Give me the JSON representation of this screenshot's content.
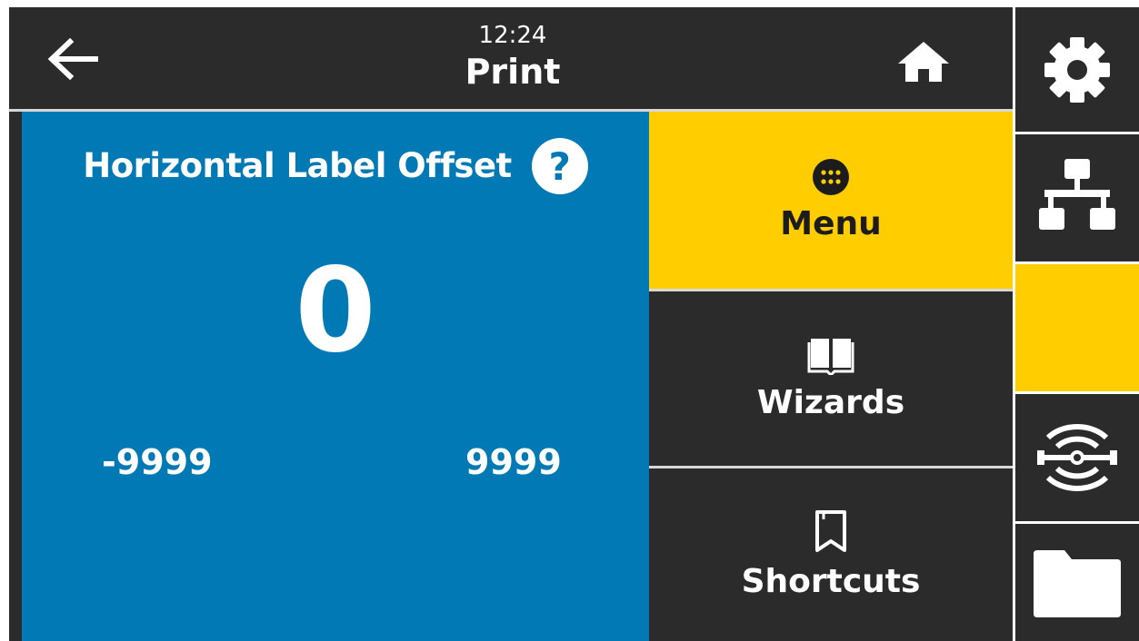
{
  "header": {
    "time": "12:24",
    "title": "Print"
  },
  "setting": {
    "title": "Horizontal Label Offset",
    "help_symbol": "?",
    "value": "0",
    "min": "-9999",
    "max": "9999"
  },
  "menu": {
    "items": [
      {
        "label": "Menu",
        "icon": "menu-dots-icon",
        "active": true
      },
      {
        "label": "Wizards",
        "icon": "book-icon",
        "active": false
      },
      {
        "label": "Shortcuts",
        "icon": "bookmark-icon",
        "active": false
      }
    ]
  },
  "sidebar": {
    "items": [
      {
        "icon": "gear-icon",
        "active": false
      },
      {
        "icon": "network-icon",
        "active": false
      },
      {
        "icon": "print-icon",
        "active": true
      },
      {
        "icon": "rfid-icon",
        "active": false
      },
      {
        "icon": "folder-icon",
        "active": false
      }
    ]
  },
  "colors": {
    "panel_blue": "#0079b4",
    "accent_yellow": "#ffcd00",
    "dark_bg": "#2b2b2b"
  }
}
